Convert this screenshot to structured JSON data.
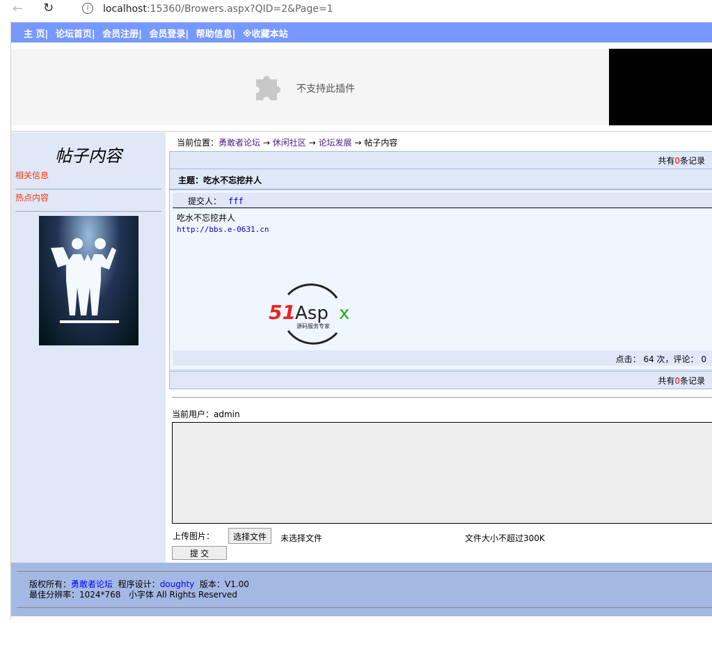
{
  "browser": {
    "url_host": "localhost",
    "url_rest": ":15360/Browers.aspx?QID=2&Page=1"
  },
  "nav": [
    "主  页|",
    "论坛首页|",
    "会员注册|",
    "会员登录|",
    "帮助信息|",
    "※收藏本站"
  ],
  "plugin": {
    "message": "不支持此插件"
  },
  "sidebar": {
    "title": "帖子内容",
    "items": [
      "相关信息",
      "热点内容"
    ]
  },
  "breadcrumb": {
    "label": "当前位置：",
    "items": [
      "勇敢者论坛",
      "休闲社区",
      "论坛发展"
    ],
    "current": "帖子内容",
    "sep": "→"
  },
  "records": {
    "prefix": "共有",
    "count": "0",
    "suffix": "条记录"
  },
  "post": {
    "subject": "主题：吃水不忘挖井人",
    "author_label": "提交人：",
    "author": "fff",
    "content": "吃水不忘挖井人",
    "link": "http://bbs.e-0631.cn",
    "logo_text": "51Aspx",
    "logo_sub": "源码服务专家",
    "stats": "点击： 64 次，评论： 0"
  },
  "reply": {
    "current_user": "当前用户：admin",
    "upload_label": "上传图片：",
    "choose_file": "选择文件",
    "no_file": "未选择文件",
    "size_limit": "文件大小不超过300K",
    "submit": "提 交"
  },
  "footer": {
    "copyright_label": "版权所有：",
    "site": "勇敢者论坛",
    "designer_label": "程序设计：",
    "designer": "doughty",
    "version": "版本：V1.00",
    "line2": "最佳分辨率：1024*768   小字体 All Rights Reserved"
  }
}
